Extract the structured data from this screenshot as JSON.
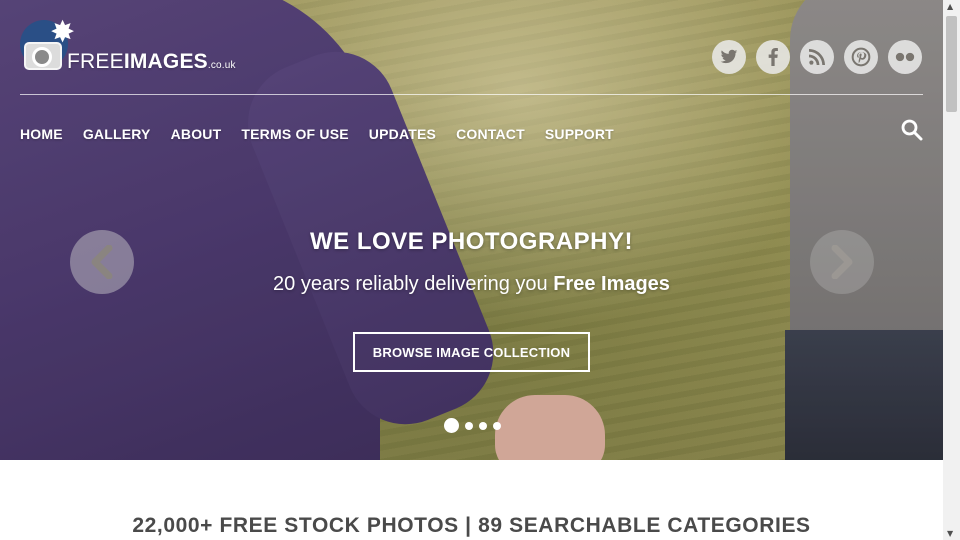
{
  "logo": {
    "brand_light": "FREE",
    "brand_bold": "IMAGES",
    "brand_tld": ".co.uk"
  },
  "socials": [
    {
      "icon": "twitter-icon",
      "glyph": "⚑"
    },
    {
      "icon": "facebook-icon",
      "glyph": "f"
    },
    {
      "icon": "rss-icon",
      "glyph": "◢"
    },
    {
      "icon": "pinterest-icon",
      "glyph": "P"
    },
    {
      "icon": "flickr-icon",
      "glyph": "●●"
    }
  ],
  "nav": {
    "items": [
      "HOME",
      "GALLERY",
      "ABOUT",
      "TERMS OF USE",
      "UPDATES",
      "CONTACT",
      "SUPPORT"
    ]
  },
  "hero": {
    "title": "WE LOVE PHOTOGRAPHY!",
    "subtitle_lead": "20 years reliably delivering you ",
    "subtitle_bold": "Free Images",
    "button_label": "BROWSE IMAGE COLLECTION",
    "active_slide": 1,
    "slide_count": 4
  },
  "tagline": "22,000+ FREE STOCK PHOTOS | 89 SEARCHABLE CATEGORIES",
  "colors": {
    "logo_circle": "#2a4f86",
    "text_light": "#ffffff",
    "tagline_text": "#4a4a4a"
  }
}
